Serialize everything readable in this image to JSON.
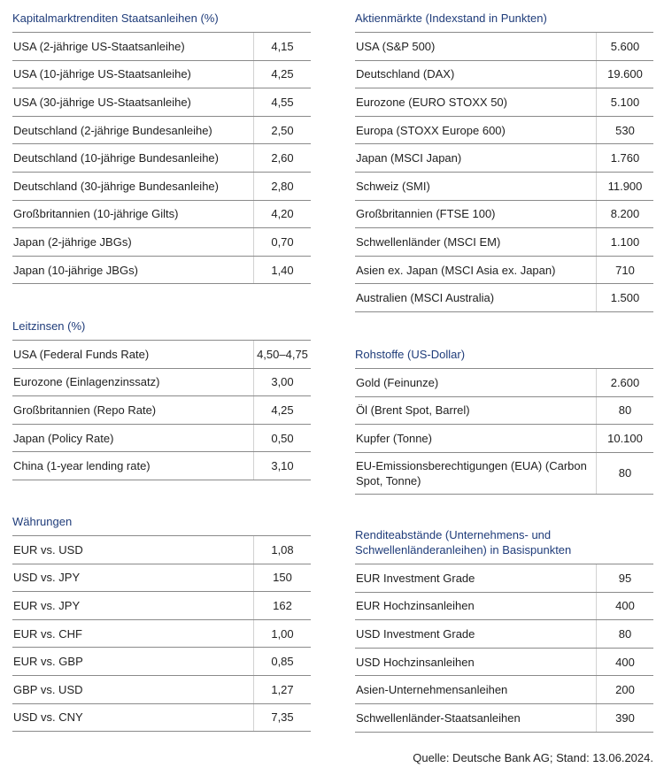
{
  "bonds": {
    "title": "Kapitalmarktrenditen Staatsanleihen (%)",
    "rows": [
      {
        "label": "USA (2-jährige US-Staatsanleihe)",
        "value": "4,15"
      },
      {
        "label": "USA (10-jährige US-Staatsanleihe)",
        "value": "4,25"
      },
      {
        "label": "USA (30-jährige US-Staatsanleihe)",
        "value": "4,55"
      },
      {
        "label": "Deutschland (2-jährige Bundesanleihe)",
        "value": "2,50"
      },
      {
        "label": "Deutschland (10-jährige Bundesanleihe)",
        "value": "2,60"
      },
      {
        "label": "Deutschland (30-jährige Bundesanleihe)",
        "value": "2,80"
      },
      {
        "label": "Großbritannien (10-jährige Gilts)",
        "value": "4,20"
      },
      {
        "label": "Japan (2-jährige JBGs)",
        "value": "0,70"
      },
      {
        "label": "Japan (10-jährige JBGs)",
        "value": "1,40"
      }
    ]
  },
  "rates": {
    "title": "Leitzinsen (%)",
    "rows": [
      {
        "label": "USA (Federal Funds Rate)",
        "value": "4,50–4,75"
      },
      {
        "label": "Eurozone (Einlagenzinssatz)",
        "value": "3,00"
      },
      {
        "label": "Großbritannien (Repo Rate)",
        "value": "4,25"
      },
      {
        "label": "Japan (Policy Rate)",
        "value": "0,50"
      },
      {
        "label": "China (1-year lending rate)",
        "value": "3,10"
      }
    ]
  },
  "fx": {
    "title": "Währungen",
    "rows": [
      {
        "label": "EUR vs. USD",
        "value": "1,08"
      },
      {
        "label": "USD vs. JPY",
        "value": "150"
      },
      {
        "label": "EUR vs. JPY",
        "value": "162"
      },
      {
        "label": "EUR vs. CHF",
        "value": "1,00"
      },
      {
        "label": "EUR vs. GBP",
        "value": "0,85"
      },
      {
        "label": "GBP vs. USD",
        "value": "1,27"
      },
      {
        "label": "USD vs. CNY",
        "value": "7,35"
      }
    ]
  },
  "equities": {
    "title": "Aktienmärkte (Indexstand in Punkten)",
    "rows": [
      {
        "label": "USA (S&P 500)",
        "value": "5.600"
      },
      {
        "label": "Deutschland (DAX)",
        "value": "19.600"
      },
      {
        "label": "Eurozone (EURO STOXX 50)",
        "value": "5.100"
      },
      {
        "label": "Europa (STOXX Europe 600)",
        "value": "530"
      },
      {
        "label": "Japan (MSCI Japan)",
        "value": "1.760"
      },
      {
        "label": "Schweiz (SMI)",
        "value": "11.900"
      },
      {
        "label": "Großbritannien (FTSE 100)",
        "value": "8.200"
      },
      {
        "label": "Schwellenländer (MSCI EM)",
        "value": "1.100"
      },
      {
        "label": "Asien ex. Japan (MSCI Asia ex. Japan)",
        "value": "710"
      },
      {
        "label": "Australien (MSCI Australia)",
        "value": "1.500"
      }
    ]
  },
  "commodities": {
    "title": "Rohstoffe (US-Dollar)",
    "rows": [
      {
        "label": "Gold (Feinunze)",
        "value": "2.600"
      },
      {
        "label": "Öl (Brent Spot, Barrel)",
        "value": "80"
      },
      {
        "label": "Kupfer (Tonne)",
        "value": "10.100"
      },
      {
        "label": "EU-Emissionsberechtigungen (EUA) (Carbon Spot, Tonne)",
        "value": "80"
      }
    ]
  },
  "spreads": {
    "title": "Renditeabstände (Unternehmens- und Schwellenländeranleihen) in Basispunkten",
    "rows": [
      {
        "label": "EUR Investment Grade",
        "value": "95"
      },
      {
        "label": "EUR Hochzinsanleihen",
        "value": "400"
      },
      {
        "label": "USD Investment Grade",
        "value": "80"
      },
      {
        "label": "USD Hochzinsanleihen",
        "value": "400"
      },
      {
        "label": "Asien-Unternehmensanleihen",
        "value": "200"
      },
      {
        "label": "Schwellenländer-Staatsanleihen",
        "value": "390"
      }
    ]
  },
  "source": "Quelle: Deutsche Bank AG; Stand: 13.06.2024."
}
